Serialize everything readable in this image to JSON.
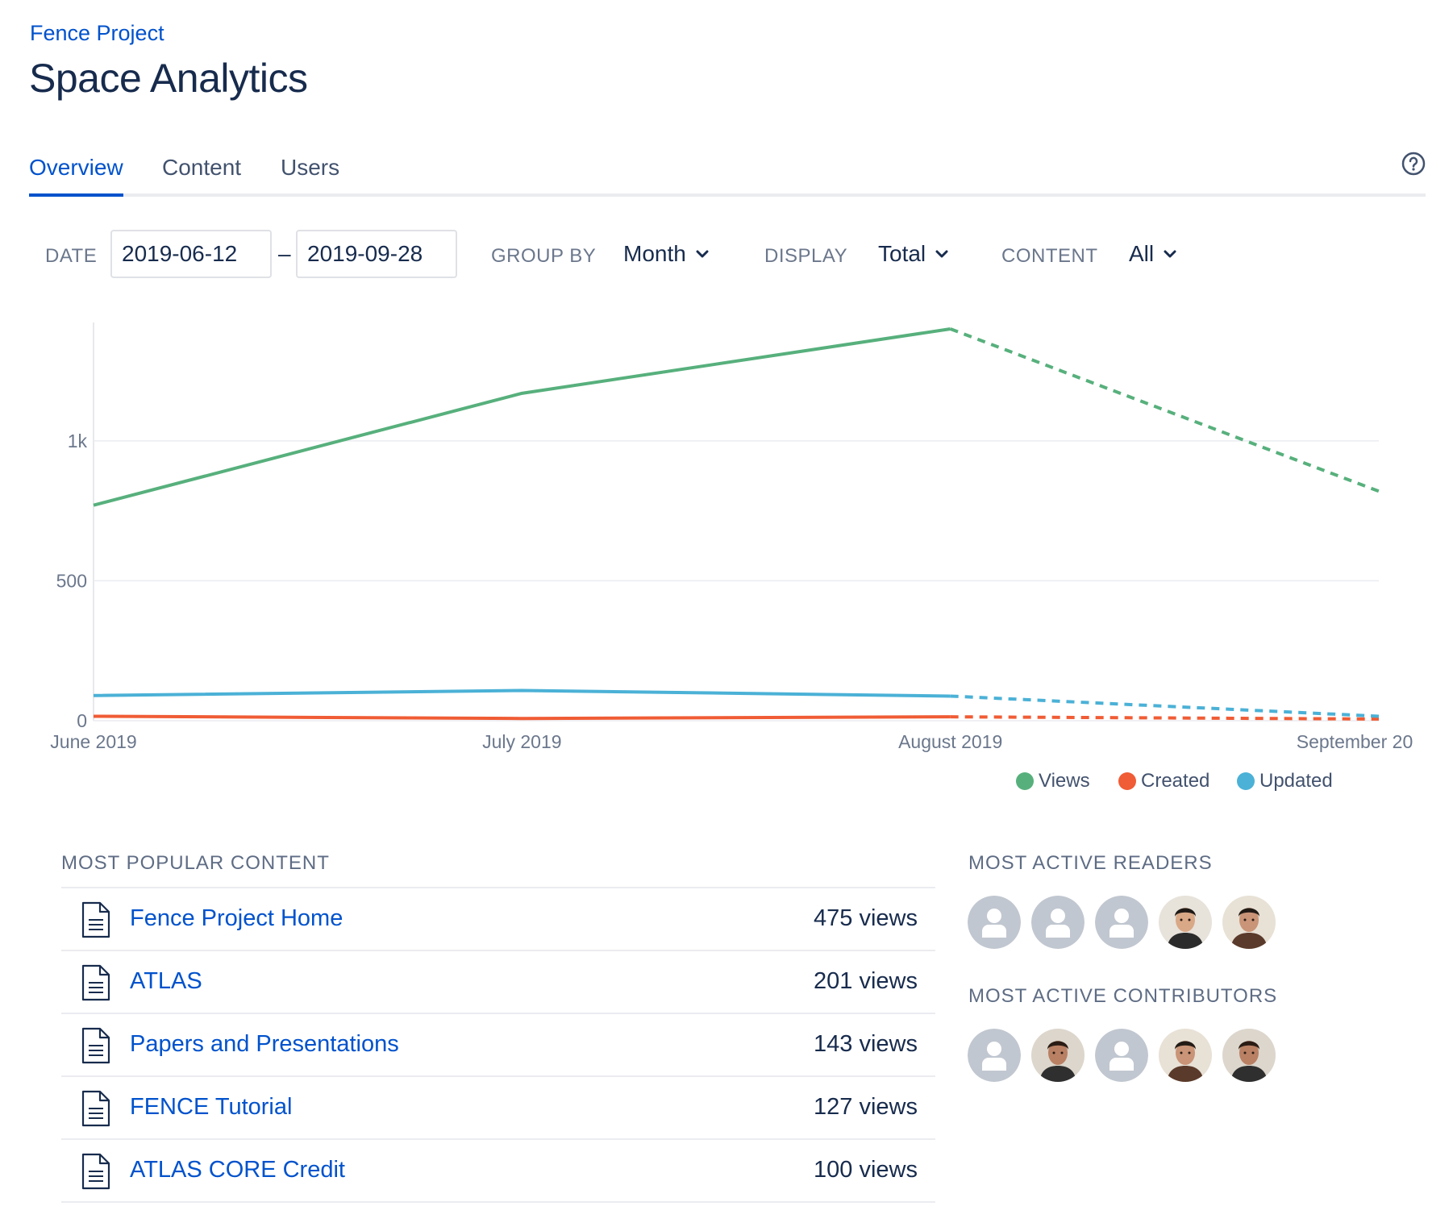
{
  "breadcrumb": "Fence Project",
  "page_title": "Space Analytics",
  "tabs": [
    {
      "label": "Overview",
      "active": true
    },
    {
      "label": "Content",
      "active": false
    },
    {
      "label": "Users",
      "active": false
    }
  ],
  "filters": {
    "date_label": "DATE",
    "date_from": "2019-06-12",
    "date_separator": "–",
    "date_to": "2019-09-28",
    "group_by_label": "GROUP BY",
    "group_by_value": "Month",
    "display_label": "DISPLAY",
    "display_value": "Total",
    "content_label": "CONTENT",
    "content_value": "All"
  },
  "chart_data": {
    "type": "line",
    "categories": [
      "June 2019",
      "July 2019",
      "August 2019",
      "September 20"
    ],
    "series": [
      {
        "name": "Views",
        "color": "#57B07C",
        "values": [
          770,
          1170,
          1400,
          820
        ]
      },
      {
        "name": "Created",
        "color": "#F05C35",
        "values": [
          16,
          8,
          14,
          6
        ]
      },
      {
        "name": "Updated",
        "color": "#4BB1D6",
        "values": [
          90,
          108,
          88,
          16
        ]
      }
    ],
    "projected_from_index": 2,
    "yticks": [
      {
        "value": 0,
        "label": "0"
      },
      {
        "value": 500,
        "label": "500"
      },
      {
        "value": 1000,
        "label": "1k"
      }
    ],
    "ylim": [
      0,
      1400
    ],
    "grid": true,
    "legend_position": "bottom-right",
    "title": "",
    "xlabel": "",
    "ylabel": ""
  },
  "legend": [
    {
      "label": "Views",
      "color": "#57B07C"
    },
    {
      "label": "Created",
      "color": "#F05C35"
    },
    {
      "label": "Updated",
      "color": "#4BB1D6"
    }
  ],
  "popular": {
    "title": "MOST POPULAR CONTENT",
    "items": [
      {
        "title": "Fence Project Home",
        "views": "475 views"
      },
      {
        "title": "ATLAS",
        "views": "201 views"
      },
      {
        "title": "Papers and Presentations",
        "views": "143 views"
      },
      {
        "title": "FENCE Tutorial",
        "views": "127 views"
      },
      {
        "title": "ATLAS CORE Credit",
        "views": "100 views"
      }
    ]
  },
  "readers": {
    "title": "MOST ACTIVE READERS",
    "avatars": [
      "default",
      "default",
      "default",
      "photo",
      "photo"
    ]
  },
  "contributors": {
    "title": "MOST ACTIVE CONTRIBUTORS",
    "avatars": [
      "default",
      "photo",
      "default",
      "photo",
      "photo"
    ]
  },
  "icons": {
    "help": "help-circle-icon",
    "chevron": "chevron-down-icon",
    "document": "document-icon",
    "avatar_default": "default-avatar-icon"
  }
}
